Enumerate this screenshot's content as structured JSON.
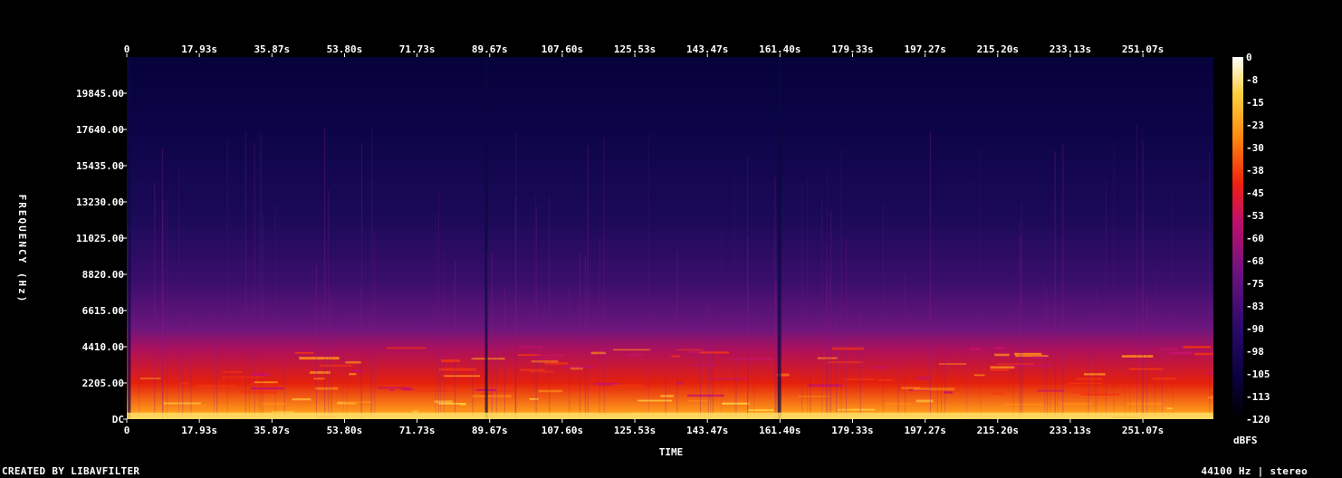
{
  "chart_data": {
    "type": "heatmap",
    "title": "",
    "xlabel": "TIME",
    "ylabel": "FREQUENCY (Hz)",
    "x_ticks": [
      "0",
      "17.93s",
      "35.87s",
      "53.80s",
      "71.73s",
      "89.67s",
      "107.60s",
      "125.53s",
      "143.47s",
      "161.40s",
      "179.33s",
      "197.27s",
      "215.20s",
      "233.13s",
      "251.07s"
    ],
    "x_tick_values": [
      0,
      17.93,
      35.87,
      53.8,
      71.73,
      89.67,
      107.6,
      125.53,
      143.47,
      161.4,
      179.33,
      197.27,
      215.2,
      233.13,
      251.07
    ],
    "xlim": [
      0,
      268.5
    ],
    "y_ticks": [
      "DC",
      "2205.00",
      "4410.00",
      "6615.00",
      "8820.00",
      "11025.00",
      "13230.00",
      "15435.00",
      "17640.00",
      "19845.00"
    ],
    "y_tick_values": [
      0,
      2205,
      4410,
      6615,
      8820,
      11025,
      13230,
      15435,
      17640,
      19845
    ],
    "ylim": [
      0,
      22050
    ],
    "colorbar": {
      "label": "dBFS",
      "ticks": [
        "0",
        "-8",
        "-15",
        "-23",
        "-30",
        "-38",
        "-45",
        "-53",
        "-60",
        "-68",
        "-75",
        "-83",
        "-90",
        "-98",
        "-105",
        "-113",
        "-120"
      ],
      "range": [
        -120,
        0
      ]
    },
    "colors": {
      "background": "#000000",
      "low": "#02023a",
      "mid_low": "#2e0e6e",
      "mid": "#7a1480",
      "mid_high": "#e01a10",
      "high": "#ffd040",
      "peak": "#ffffff"
    }
  },
  "footer": {
    "left": "CREATED BY LIBAVFILTER",
    "right": "44100 Hz | stereo"
  }
}
